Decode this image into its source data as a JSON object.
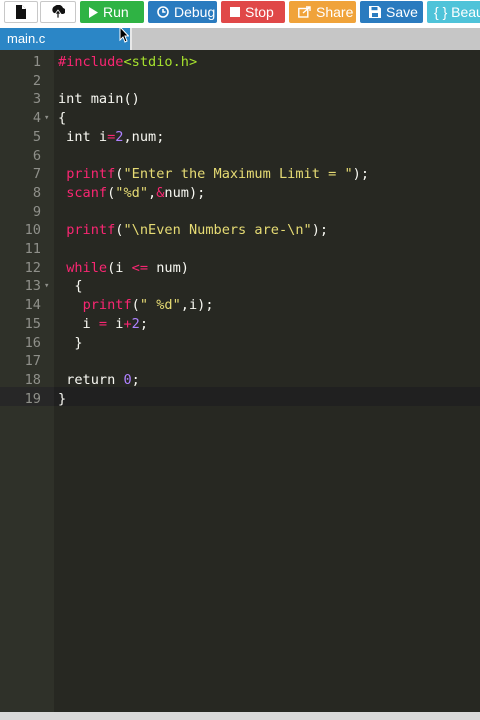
{
  "toolbar": {
    "new_file_icon": "file-icon",
    "upload_icon": "upload-icon",
    "run_label": "Run",
    "debug_label": "Debug",
    "stop_label": "Stop",
    "share_label": "Share",
    "save_label": "Save",
    "beautify_label": "{ } Beau",
    "colors": {
      "run": "#2fb344",
      "debug": "#2a7bbf",
      "stop": "#e04848",
      "share": "#f0a33a",
      "save": "#2a7bbf",
      "beautify": "#4fc3d9"
    }
  },
  "tabs": [
    {
      "label": "main.c"
    }
  ],
  "editor": {
    "lines": [
      {
        "n": "1",
        "fold": "",
        "tokens": [
          {
            "t": "#include",
            "c": "pre"
          },
          {
            "t": "<stdio.h>",
            "c": "inc"
          }
        ]
      },
      {
        "n": "2",
        "fold": "",
        "tokens": []
      },
      {
        "n": "3",
        "fold": "",
        "tokens": [
          {
            "t": "int main()",
            "c": "plain"
          }
        ]
      },
      {
        "n": "4",
        "fold": "▾",
        "tokens": [
          {
            "t": "{",
            "c": "plain"
          }
        ]
      },
      {
        "n": "5",
        "fold": "",
        "tokens": [
          {
            "t": " int i",
            "c": "plain"
          },
          {
            "t": "=",
            "c": "op"
          },
          {
            "t": "2",
            "c": "num"
          },
          {
            "t": ",num;",
            "c": "plain"
          }
        ]
      },
      {
        "n": "6",
        "fold": "",
        "tokens": []
      },
      {
        "n": "7",
        "fold": "",
        "tokens": [
          {
            "t": " ",
            "c": "plain"
          },
          {
            "t": "printf",
            "c": "fn"
          },
          {
            "t": "(",
            "c": "plain"
          },
          {
            "t": "\"Enter the Maximum Limit = \"",
            "c": "str"
          },
          {
            "t": ");",
            "c": "plain"
          }
        ]
      },
      {
        "n": "8",
        "fold": "",
        "tokens": [
          {
            "t": " ",
            "c": "plain"
          },
          {
            "t": "scanf",
            "c": "fn"
          },
          {
            "t": "(",
            "c": "plain"
          },
          {
            "t": "\"%d\"",
            "c": "str"
          },
          {
            "t": ",",
            "c": "plain"
          },
          {
            "t": "&",
            "c": "op"
          },
          {
            "t": "num);",
            "c": "plain"
          }
        ]
      },
      {
        "n": "9",
        "fold": "",
        "tokens": []
      },
      {
        "n": "10",
        "fold": "",
        "tokens": [
          {
            "t": " ",
            "c": "plain"
          },
          {
            "t": "printf",
            "c": "fn"
          },
          {
            "t": "(",
            "c": "plain"
          },
          {
            "t": "\"\\nEven Numbers are-\\n\"",
            "c": "str"
          },
          {
            "t": ");",
            "c": "plain"
          }
        ]
      },
      {
        "n": "11",
        "fold": "",
        "tokens": []
      },
      {
        "n": "12",
        "fold": "",
        "tokens": [
          {
            "t": " ",
            "c": "plain"
          },
          {
            "t": "while",
            "c": "kw"
          },
          {
            "t": "(i ",
            "c": "plain"
          },
          {
            "t": "<=",
            "c": "op"
          },
          {
            "t": " num)",
            "c": "plain"
          }
        ]
      },
      {
        "n": "13",
        "fold": "▾",
        "tokens": [
          {
            "t": "  {",
            "c": "plain"
          }
        ]
      },
      {
        "n": "14",
        "fold": "",
        "tokens": [
          {
            "t": "   ",
            "c": "plain"
          },
          {
            "t": "printf",
            "c": "fn"
          },
          {
            "t": "(",
            "c": "plain"
          },
          {
            "t": "\" %d\"",
            "c": "str"
          },
          {
            "t": ",i);",
            "c": "plain"
          }
        ]
      },
      {
        "n": "15",
        "fold": "",
        "tokens": [
          {
            "t": "   i ",
            "c": "plain"
          },
          {
            "t": "=",
            "c": "op"
          },
          {
            "t": " i",
            "c": "plain"
          },
          {
            "t": "+",
            "c": "op"
          },
          {
            "t": "2",
            "c": "num"
          },
          {
            "t": ";",
            "c": "plain"
          }
        ]
      },
      {
        "n": "16",
        "fold": "",
        "tokens": [
          {
            "t": "  }",
            "c": "plain"
          }
        ]
      },
      {
        "n": "17",
        "fold": "",
        "tokens": []
      },
      {
        "n": "18",
        "fold": "",
        "tokens": [
          {
            "t": " return ",
            "c": "plain"
          },
          {
            "t": "0",
            "c": "num"
          },
          {
            "t": ";",
            "c": "plain"
          }
        ]
      },
      {
        "n": "19",
        "fold": "",
        "tokens": [
          {
            "t": "}",
            "c": "plain"
          }
        ]
      }
    ]
  }
}
